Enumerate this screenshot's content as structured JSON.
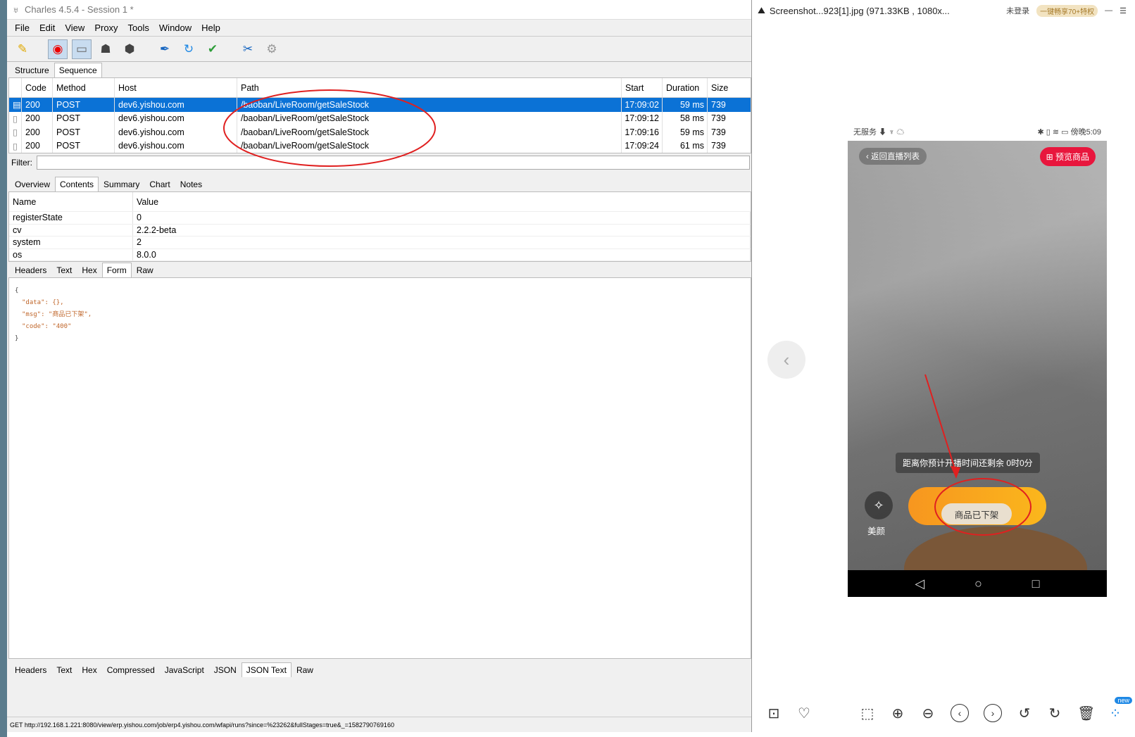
{
  "charles": {
    "title": "Charles 4.5.4 - Session 1 *",
    "menu": [
      "File",
      "Edit",
      "View",
      "Proxy",
      "Tools",
      "Window",
      "Help"
    ],
    "top_tabs": [
      "Structure",
      "Sequence"
    ],
    "columns": [
      "Code",
      "Method",
      "Host",
      "Path",
      "Start",
      "Duration",
      "Size"
    ],
    "rows": [
      {
        "code": "200",
        "method": "POST",
        "host": "dev6.yishou.com",
        "path": "/baoban/LiveRoom/getSaleStock",
        "start": "17:09:02",
        "duration": "59 ms",
        "size": "739"
      },
      {
        "code": "200",
        "method": "POST",
        "host": "dev6.yishou.com",
        "path": "/baoban/LiveRoom/getSaleStock",
        "start": "17:09:12",
        "duration": "58 ms",
        "size": "739"
      },
      {
        "code": "200",
        "method": "POST",
        "host": "dev6.yishou.com",
        "path": "/baoban/LiveRoom/getSaleStock",
        "start": "17:09:16",
        "duration": "59 ms",
        "size": "739"
      },
      {
        "code": "200",
        "method": "POST",
        "host": "dev6.yishou.com",
        "path": "/baoban/LiveRoom/getSaleStock",
        "start": "17:09:24",
        "duration": "61 ms",
        "size": "739"
      }
    ],
    "filter_label": "Filter:",
    "detail_tabs": [
      "Overview",
      "Contents",
      "Summary",
      "Chart",
      "Notes"
    ],
    "kv_headers": [
      "Name",
      "Value"
    ],
    "kv": [
      {
        "name": "registerState",
        "value": "0"
      },
      {
        "name": "cv",
        "value": "2.2.2-beta"
      },
      {
        "name": "system",
        "value": "2"
      },
      {
        "name": "os",
        "value": "8.0.0"
      }
    ],
    "req_tabs": [
      "Headers",
      "Text",
      "Hex",
      "Form",
      "Raw"
    ],
    "json_lines": [
      "{",
      "\"data\": {},",
      "\"msg\": \"商品已下架\",",
      "\"code\": \"400\"",
      "}"
    ],
    "resp_tabs": [
      "Headers",
      "Text",
      "Hex",
      "Compressed",
      "JavaScript",
      "JSON",
      "JSON Text",
      "Raw"
    ],
    "status": "GET http://192.168.1.221:8080/view/erp.yishou.com/job/erp4.yishou.com/wfapi/runs?since=%23262&fullStages=true&_=1582790769160"
  },
  "viewer": {
    "title": "Screenshot...923[1].jpg (971.33KB , 1080x...",
    "login": "未登录",
    "vip": "一键畅享70+特权",
    "phone": {
      "status_left": "无服务 ⬇ ♆ ☁",
      "status_right": "✱ ▯ ≋ ▭ 傍晚5:09",
      "back": "返回直播列表",
      "preview": "预览商品",
      "tip": "距离你预计开播时间还剩余 0时0分",
      "beauty": "美颜",
      "offshelf": "商品已下架"
    },
    "new_badge": "new"
  },
  "colors": {
    "selection": "#0b72d6",
    "annotation": "#e02020",
    "orange": "#f7961f"
  }
}
